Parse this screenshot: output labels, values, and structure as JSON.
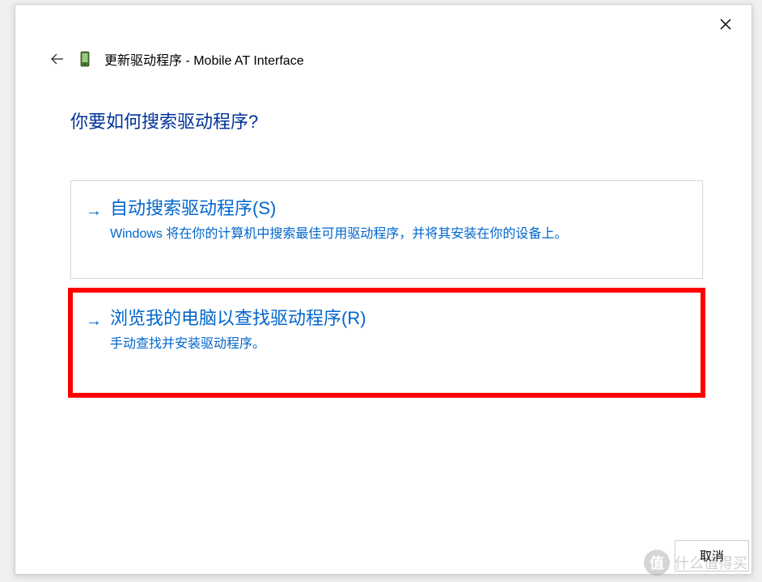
{
  "dialog": {
    "title": "更新驱动程序 - Mobile AT Interface",
    "heading": "你要如何搜索驱动程序?"
  },
  "options": [
    {
      "title": "自动搜索驱动程序(S)",
      "description": "Windows 将在你的计算机中搜索最佳可用驱动程序，并将其安装在你的设备上。",
      "highlighted": false
    },
    {
      "title": "浏览我的电脑以查找驱动程序(R)",
      "description": "手动查找并安装驱动程序。",
      "highlighted": true
    }
  ],
  "buttons": {
    "cancel": "取消"
  },
  "watermark": {
    "icon": "值",
    "text": "什么值得买"
  }
}
